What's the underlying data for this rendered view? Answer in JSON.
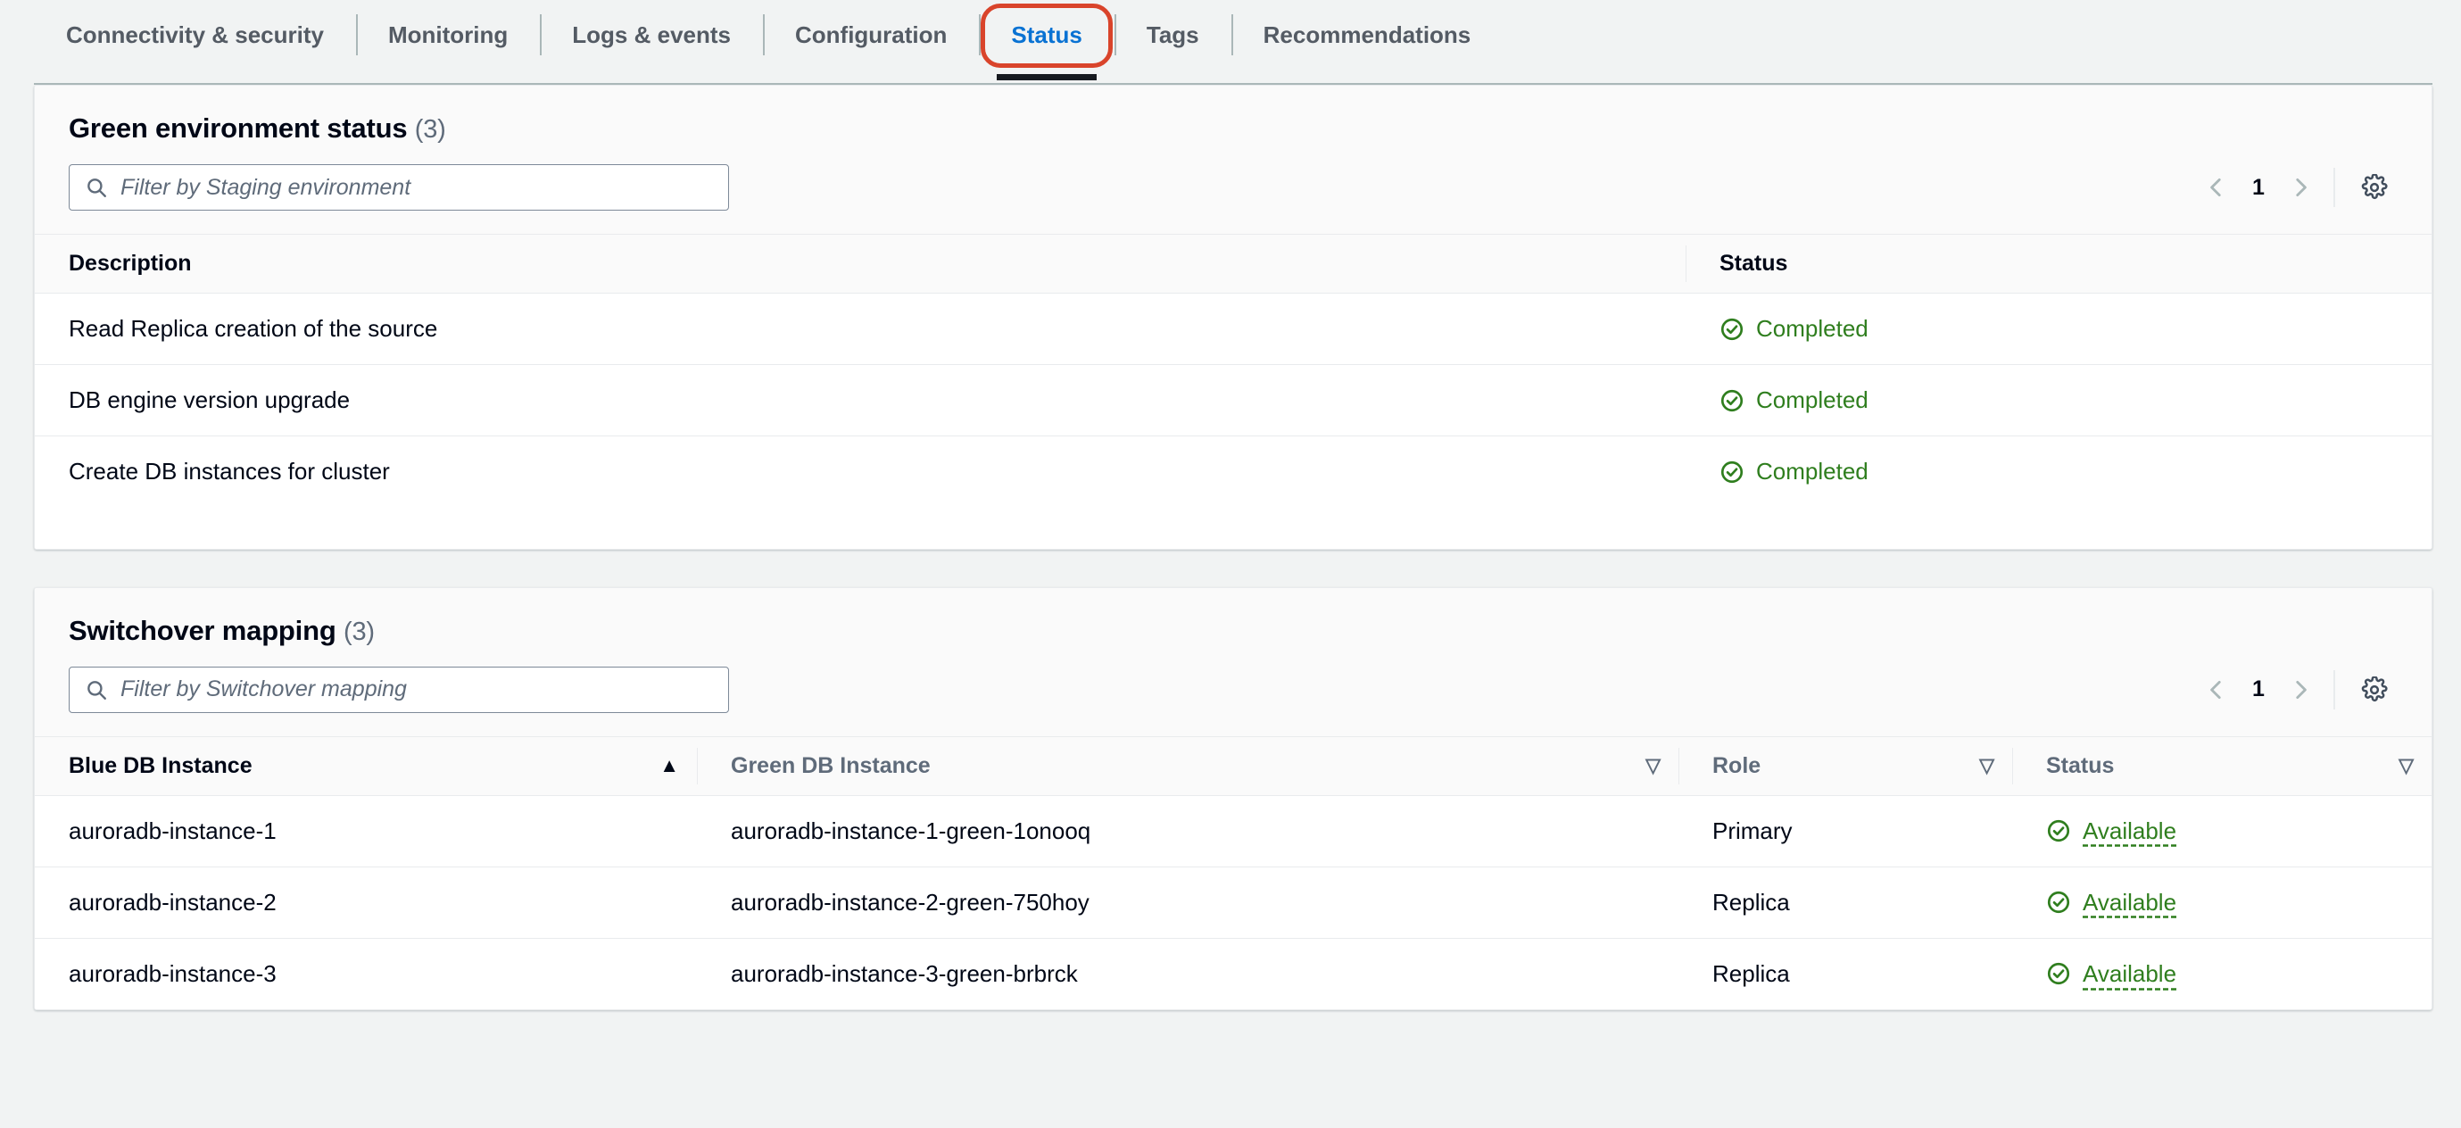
{
  "tabs": [
    {
      "label": "Connectivity & security",
      "active": false
    },
    {
      "label": "Monitoring",
      "active": false
    },
    {
      "label": "Logs & events",
      "active": false
    },
    {
      "label": "Configuration",
      "active": false
    },
    {
      "label": "Status",
      "active": true
    },
    {
      "label": "Tags",
      "active": false
    },
    {
      "label": "Recommendations",
      "active": false
    }
  ],
  "colors": {
    "active_tab_text": "#0972d3",
    "annotation_ring": "#d9442b",
    "status_green": "#2f7e1e",
    "page_background": "#f1f3f3",
    "header_background": "#fafafa"
  },
  "green_environment_status": {
    "title": "Green environment status",
    "count": "(3)",
    "filter_placeholder": "Filter by Staging environment",
    "filter_value": "",
    "pagination": {
      "page": "1",
      "prev_label": "‹",
      "next_label": "›"
    },
    "columns": [
      {
        "label": "Description",
        "sortable": false
      },
      {
        "label": "Status",
        "sortable": false
      }
    ],
    "rows": [
      {
        "description": "Read Replica creation of the source",
        "status": "Completed"
      },
      {
        "description": "DB engine version upgrade",
        "status": "Completed"
      },
      {
        "description": "Create DB instances for cluster",
        "status": "Completed"
      }
    ]
  },
  "switchover_mapping": {
    "title": "Switchover mapping",
    "count": "(3)",
    "filter_placeholder": "Filter by Switchover mapping",
    "filter_value": "",
    "pagination": {
      "page": "1",
      "prev_label": "‹",
      "next_label": "›"
    },
    "columns": [
      {
        "label": "Blue DB Instance",
        "sort": "ascending",
        "indicator": "▲"
      },
      {
        "label": "Green DB Instance",
        "sort": "none",
        "indicator": "▽"
      },
      {
        "label": "Role",
        "sort": "none",
        "indicator": "▽"
      },
      {
        "label": "Status",
        "sort": "none",
        "indicator": "▽"
      }
    ],
    "rows": [
      {
        "blue": "auroradb-instance-1",
        "green": "auroradb-instance-1-green-1onooq",
        "role": "Primary",
        "status": "Available"
      },
      {
        "blue": "auroradb-instance-2",
        "green": "auroradb-instance-2-green-750hoy",
        "role": "Replica",
        "status": "Available"
      },
      {
        "blue": "auroradb-instance-3",
        "green": "auroradb-instance-3-green-brbrck",
        "role": "Replica",
        "status": "Available"
      }
    ]
  }
}
